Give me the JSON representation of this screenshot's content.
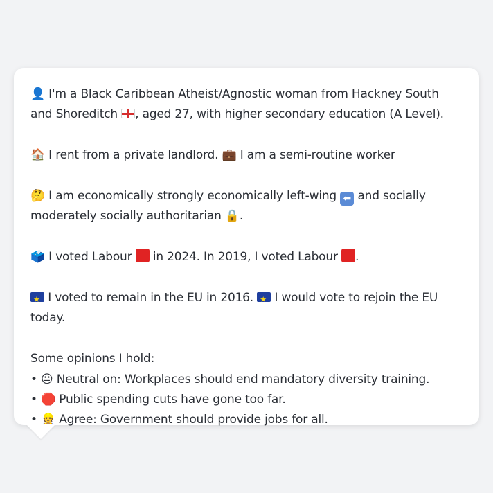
{
  "profile": {
    "p1": "👤 I'm a Black Caribbean Atheist/Agnostic woman from Hackney South and Shoreditch",
    "p1_tail": ", aged 27, with higher secondary education (A Level).",
    "p2a": "🏠 I rent from a private landlord.",
    "p2b": "💼 I am a semi-routine worker",
    "p3a": "🤔 I am economically strongly economically left-wing",
    "p3b": "and socially moderately socially authoritarian 🔒.",
    "p4a": "🗳️ I voted Labour",
    "p4b": "in 2024. In 2019, I voted Labour",
    "p4c": ".",
    "p5a": "I voted to remain in the EU in 2016.",
    "p5b": "I would vote to rejoin the EU today.",
    "opinions_heading": "Some opinions I hold:",
    "opinions": [
      "• 😐 Neutral on: Workplaces should end mandatory diversity training.",
      "• 🛑 Public spending cuts have gone too far.",
      "• 👷 Agree: Government should provide jobs for all."
    ]
  },
  "icons": {
    "england_flag": "england-flag-icon",
    "eu_flag": "eu-flag-icon",
    "labour": "red-square-icon",
    "left": "left-arrow-icon"
  },
  "colors": {
    "background": "#f2f3f5",
    "bubble": "#ffffff",
    "text": "#2b2f36",
    "labour_red": "#e02323",
    "eu_blue": "#1f3f9e"
  }
}
